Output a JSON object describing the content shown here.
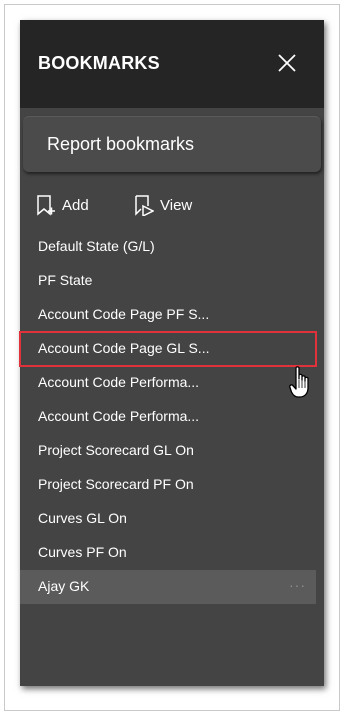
{
  "panel": {
    "title": "BOOKMARKS",
    "section_title": "Report bookmarks",
    "actions": {
      "add_label": "Add",
      "view_label": "View"
    },
    "items": [
      {
        "label": "Default State (G/L)"
      },
      {
        "label": "PF State"
      },
      {
        "label": "Account Code Page PF S..."
      },
      {
        "label": "Account Code Page GL S..."
      },
      {
        "label": "Account Code Performa..."
      },
      {
        "label": "Account Code Performa..."
      },
      {
        "label": "Project Scorecard GL On"
      },
      {
        "label": "Project Scorecard PF On"
      },
      {
        "label": "Curves GL On"
      },
      {
        "label": "Curves PF On"
      },
      {
        "label": "Ajay GK",
        "more": "···"
      }
    ],
    "highlighted_item_index": 3,
    "selected_item_index": 10
  },
  "colors": {
    "panel_bg": "#444444",
    "header_bg": "#252525",
    "highlight_border": "#e0323a",
    "selected_bg": "#5b5b5b"
  },
  "icons": {
    "close": "close-icon",
    "add": "add-bookmark-icon",
    "view": "view-bookmark-icon",
    "cursor": "hand-pointer-icon"
  }
}
